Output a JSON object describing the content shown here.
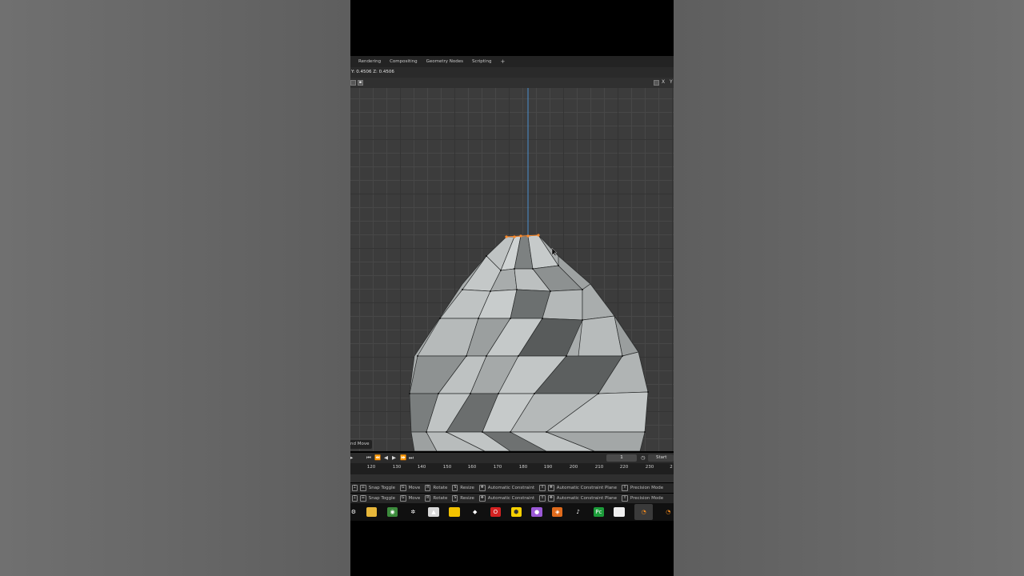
{
  "workspace_tabs": [
    "Rendering",
    "Compositing",
    "Geometry Nodes",
    "Scripting"
  ],
  "add_tab_glyph": "+",
  "header_readout": "Y: 0.4506  Z: 0.4506",
  "viewport_gizmo": {
    "x_label": "X",
    "y_label": "Y"
  },
  "operator_label": "nd Move",
  "timeline": {
    "current_frame": "1",
    "start_label": "Start",
    "ticks": [
      "120",
      "130",
      "140",
      "150",
      "160",
      "170",
      "180",
      "190",
      "200",
      "210",
      "220",
      "230",
      "2"
    ]
  },
  "status_bar_rows": [
    [
      {
        "keys": [
          "⌶",
          "☰"
        ],
        "label": "Snap Toggle"
      },
      {
        "keys": [
          "G"
        ],
        "label": "Move"
      },
      {
        "keys": [
          "R"
        ],
        "label": "Rotate"
      },
      {
        "keys": [
          "S"
        ],
        "label": "Resize"
      },
      {
        "keys": [
          "✥"
        ],
        "label": "Automatic Constraint"
      },
      {
        "keys": [
          "⇧",
          "✥"
        ],
        "label": "Automatic Constraint Plane"
      },
      {
        "keys": [
          "⇧"
        ],
        "label": "Precision Mode"
      }
    ],
    [
      {
        "keys": [
          "⌶",
          "☰"
        ],
        "label": "Snap Toggle"
      },
      {
        "keys": [
          "G"
        ],
        "label": "Move"
      },
      {
        "keys": [
          "R"
        ],
        "label": "Rotate"
      },
      {
        "keys": [
          "S"
        ],
        "label": "Resize"
      },
      {
        "keys": [
          "✥"
        ],
        "label": "Automatic Constraint"
      },
      {
        "keys": [
          "⇧",
          "✥"
        ],
        "label": "Automatic Constraint Plane"
      },
      {
        "keys": [
          "⇧"
        ],
        "label": "Precision Mode"
      }
    ]
  ],
  "taskbar_icons": [
    {
      "name": "settings-icon",
      "color": "#101010",
      "glyph": "⚙"
    },
    {
      "name": "file-explorer-icon",
      "color": "#e8b73a",
      "glyph": ""
    },
    {
      "name": "chrome-icon",
      "color": "#3c8b3c",
      "glyph": "◉"
    },
    {
      "name": "app-icon",
      "color": "#101010",
      "glyph": "✲"
    },
    {
      "name": "inkscape-icon",
      "color": "#d8d8d8",
      "glyph": "▲"
    },
    {
      "name": "sticky-notes-icon",
      "color": "#f2c200",
      "glyph": ""
    },
    {
      "name": "unity-icon",
      "color": "#101010",
      "glyph": "◆"
    },
    {
      "name": "opera-icon",
      "color": "#d42222",
      "glyph": "O"
    },
    {
      "name": "miro-icon",
      "color": "#f5d000",
      "glyph": "⬢"
    },
    {
      "name": "color-wheel-icon",
      "color": "#9b59d6",
      "glyph": "●"
    },
    {
      "name": "substance-icon",
      "color": "#e06b1c",
      "glyph": "◈"
    },
    {
      "name": "tiktok-icon",
      "color": "#101010",
      "glyph": "♪"
    },
    {
      "name": "pycharm-icon",
      "color": "#1c9c3a",
      "glyph": "Pc"
    },
    {
      "name": "document-icon",
      "color": "#eeeeee",
      "glyph": ""
    },
    {
      "name": "blender-icon-active",
      "color": "#3a3a3a",
      "glyph": "◔"
    },
    {
      "name": "blender-icon",
      "color": "#101010",
      "glyph": "◔"
    }
  ],
  "colors": {
    "selection_orange": "#ff8a2a",
    "z_axis_blue": "#4a8fd0",
    "mesh_light": "#b8bcbc",
    "mesh_dark": "#595c5c"
  }
}
